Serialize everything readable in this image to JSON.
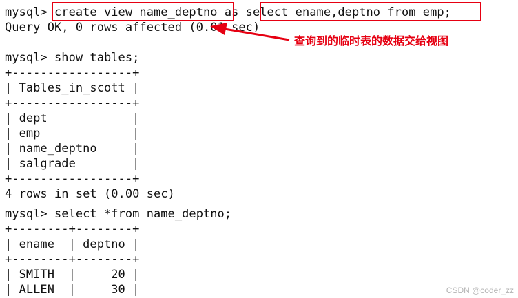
{
  "terminal": {
    "lines": [
      "mysql> create view name_deptno as select ename,deptno from emp;",
      "Query OK, 0 rows affected (0.01 sec)",
      "",
      "mysql> show tables;",
      "+-----------------+",
      "| Tables_in_scott |",
      "+-----------------+",
      "| dept            |",
      "| emp             |",
      "| name_deptno     |",
      "| salgrade        |",
      "+-----------------+",
      "4 rows in set (0.00 sec)",
      "mysql> select *from name_deptno;",
      "+--------+--------+",
      "| ename  | deptno |",
      "+--------+--------+",
      "| SMITH  |     20 |",
      "| ALLEN  |     30 |"
    ]
  },
  "annotation": {
    "text": "查询到的临时表的数据交给视图",
    "color": "#e60012"
  },
  "watermark": {
    "text": "CSDN @coder_zz"
  }
}
